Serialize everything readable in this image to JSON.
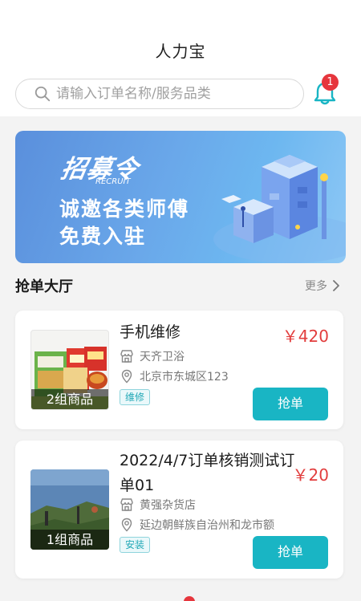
{
  "header": {
    "title": "人力宝",
    "search_placeholder": "请输入订单名称/服务品类",
    "notification_count": "1"
  },
  "banner": {
    "logo_text": "招募令",
    "logo_sub": "RECRUIT",
    "line1": "诚邀各类师傅",
    "line2": "免费入驻"
  },
  "section": {
    "title": "抢单大厅",
    "more_label": "更多"
  },
  "orders": [
    {
      "title": "手机维修",
      "price": "￥420",
      "shop": "天齐卫浴",
      "address": "北京市东城区123",
      "tag": "维修",
      "goods": "2组商品",
      "button": "抢单"
    },
    {
      "title_line1": "2022/4/7订单核销测试订",
      "title_line2": "单01",
      "price": "￥20",
      "shop": "黄强杂货店",
      "address": "延边朝鲜族自治州和龙市额",
      "tag": "安装",
      "goods": "1组商品",
      "button": "抢单"
    }
  ],
  "colors": {
    "accent": "#19b5c4",
    "price": "#e23d3d",
    "badge": "#e6363d"
  }
}
